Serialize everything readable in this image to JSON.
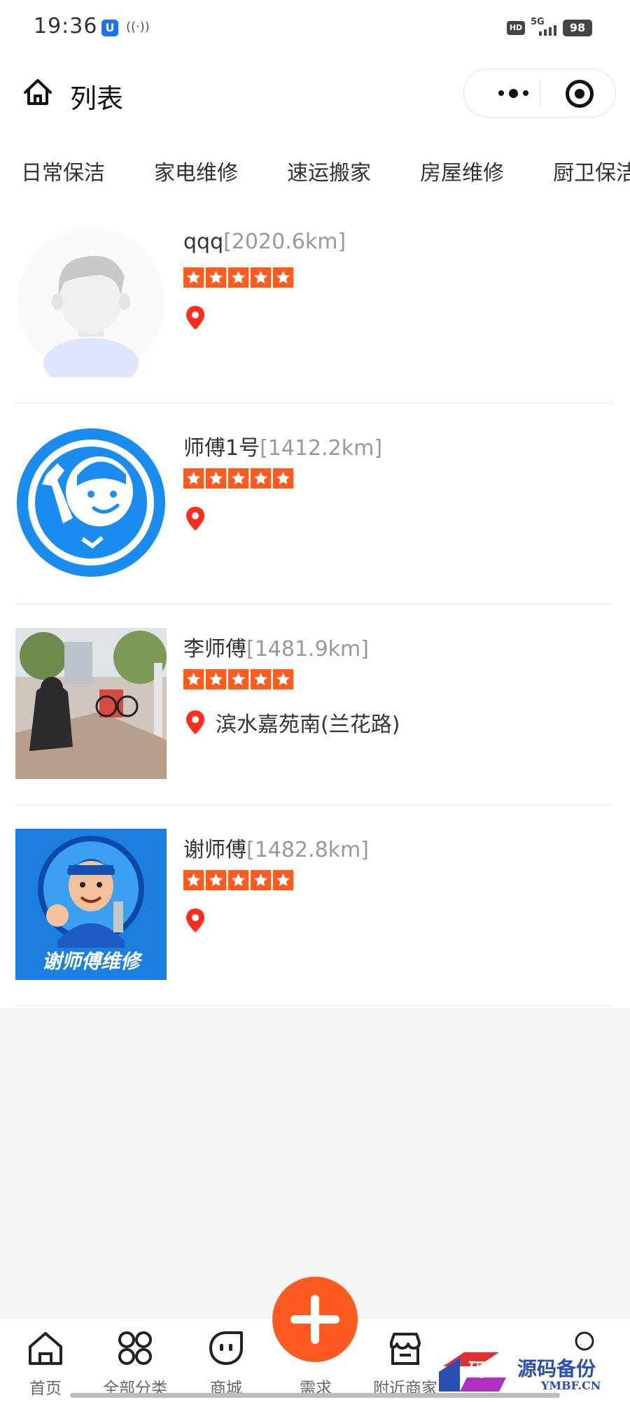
{
  "status_bar": {
    "time": "19:36",
    "hd": "HD",
    "network": "5G",
    "battery": "98"
  },
  "header": {
    "title": "列表"
  },
  "categories": [
    "日常保洁",
    "家电维修",
    "速运搬家",
    "房屋维修",
    "厨卫保洁"
  ],
  "workers": [
    {
      "name": "qqq",
      "distance": "[2020.6km]",
      "rating": 5,
      "address": "",
      "avatar": "default-avatar"
    },
    {
      "name": "师傅1号",
      "distance": "[1412.2km]",
      "rating": 5,
      "address": "",
      "avatar": "repairman-logo"
    },
    {
      "name": "李师傅",
      "distance": "[1481.9km]",
      "rating": 5,
      "address": "滨水嘉苑南(兰花路)",
      "avatar": "street-photo"
    },
    {
      "name": "谢师傅",
      "distance": "[1482.8km]",
      "rating": 5,
      "address": "",
      "avatar": "cartoon-repairman",
      "avatar_caption": "谢师傅维修"
    }
  ],
  "tabbar": {
    "items": [
      {
        "label": "首页",
        "icon": "home-icon"
      },
      {
        "label": "全部分类",
        "icon": "grid-icon"
      },
      {
        "label": "商城",
        "icon": "mall-icon"
      },
      {
        "label": "需求",
        "icon": "plus-icon"
      },
      {
        "label": "附近商家",
        "icon": "store-icon"
      },
      {
        "label": "",
        "icon": "user-icon"
      }
    ]
  },
  "colors": {
    "accent": "#ff5a1f",
    "pin": "#ff2d1f",
    "brand_blue": "#1a8cf0"
  },
  "watermark": {
    "title": "源码备份",
    "domain": "YMBF.CN"
  }
}
